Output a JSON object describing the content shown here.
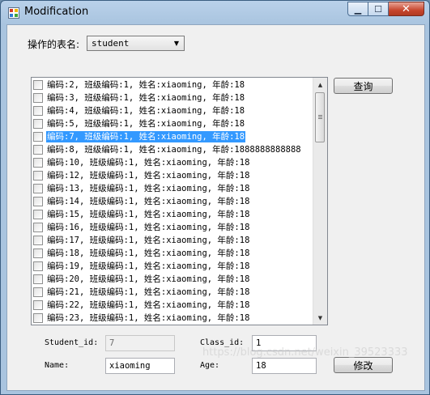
{
  "window": {
    "title": "Modification"
  },
  "table_select": {
    "label": "操作的表名:",
    "value": "student"
  },
  "query_button": "查询",
  "modify_button": "修改",
  "list_items": [
    {
      "text": "编码:2,  班级编码:1, 姓名:xiaoming, 年龄:18",
      "selected": false
    },
    {
      "text": "编码:3,  班级编码:1, 姓名:xiaoming, 年龄:18",
      "selected": false
    },
    {
      "text": "编码:4,  班级编码:1, 姓名:xiaoming, 年龄:18",
      "selected": false
    },
    {
      "text": "编码:5,  班级编码:1, 姓名:xiaoming, 年龄:18",
      "selected": false
    },
    {
      "text": "编码:7,  班级编码:1, 姓名:xiaoming, 年龄:18",
      "selected": true
    },
    {
      "text": "编码:8,  班级编码:1, 姓名:xiaoming, 年龄:1888888888888",
      "selected": false
    },
    {
      "text": "编码:10,  班级编码:1, 姓名:xiaoming, 年龄:18",
      "selected": false
    },
    {
      "text": "编码:12,  班级编码:1, 姓名:xiaoming, 年龄:18",
      "selected": false
    },
    {
      "text": "编码:13,  班级编码:1, 姓名:xiaoming, 年龄:18",
      "selected": false
    },
    {
      "text": "编码:14,  班级编码:1, 姓名:xiaoming, 年龄:18",
      "selected": false
    },
    {
      "text": "编码:15,  班级编码:1, 姓名:xiaoming, 年龄:18",
      "selected": false
    },
    {
      "text": "编码:16,  班级编码:1, 姓名:xiaoming, 年龄:18",
      "selected": false
    },
    {
      "text": "编码:17,  班级编码:1, 姓名:xiaoming, 年龄:18",
      "selected": false
    },
    {
      "text": "编码:18,  班级编码:1, 姓名:xiaoming, 年龄:18",
      "selected": false
    },
    {
      "text": "编码:19,  班级编码:1, 姓名:xiaoming, 年龄:18",
      "selected": false
    },
    {
      "text": "编码:20,  班级编码:1, 姓名:xiaoming, 年龄:18",
      "selected": false
    },
    {
      "text": "编码:21,  班级编码:1, 姓名:xiaoming, 年龄:18",
      "selected": false
    },
    {
      "text": "编码:22,  班级编码:1, 姓名:xiaoming, 年龄:18",
      "selected": false
    },
    {
      "text": "编码:23,  班级编码:1, 姓名:xiaoming, 年龄:18",
      "selected": false
    }
  ],
  "fields": {
    "student_id": {
      "label": "Student_id:",
      "value": "7"
    },
    "class_id": {
      "label": "Class_id:",
      "value": "1"
    },
    "name": {
      "label": "Name:",
      "value": "xiaoming"
    },
    "age": {
      "label": "Age:",
      "value": "18"
    }
  },
  "watermark": "https://blog.csdn.net/weixin_39523333",
  "colors": {
    "selection": "#3399ff",
    "close_button": "#c7462e",
    "frame": "#a9c4df"
  }
}
